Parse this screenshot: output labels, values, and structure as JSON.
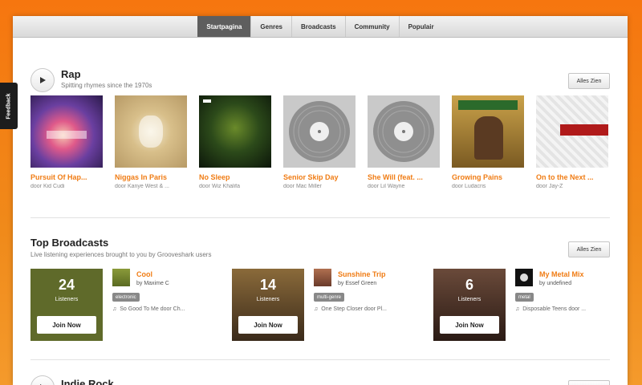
{
  "nav": {
    "tabs": [
      "Startpagina",
      "Genres",
      "Broadcasts",
      "Community",
      "Populair"
    ],
    "active": 0
  },
  "feedback": "Feedback",
  "rap": {
    "title": "Rap",
    "subtitle": "Spitting rhymes since the 1970s",
    "see_all": "Alles Zien",
    "albums": [
      {
        "title": "Pursuit Of Hap...",
        "artist": "door Kid Cudi"
      },
      {
        "title": "Niggas In Paris",
        "artist": "door Kanye West & ..."
      },
      {
        "title": "No Sleep",
        "artist": "door Wiz Khalifa"
      },
      {
        "title": "Senior Skip Day",
        "artist": "door Mac Miller"
      },
      {
        "title": "She Will (feat. ...",
        "artist": "door Lil Wayne"
      },
      {
        "title": "Growing Pains",
        "artist": "door Ludacris"
      },
      {
        "title": "On to the Next ...",
        "artist": "door Jay-Z"
      }
    ]
  },
  "broadcasts": {
    "title": "Top Broadcasts",
    "subtitle": "Live listening experiences brought to you by Grooveshark users",
    "see_all": "Alles Zien",
    "items": [
      {
        "count": "24",
        "listeners": "Listeners",
        "join": "Join Now",
        "name": "Cool",
        "by": "by Maxime C",
        "tag": "electronic",
        "song": "So Good To Me door Ch..."
      },
      {
        "count": "14",
        "listeners": "Listeners",
        "join": "Join Now",
        "name": "Sunshine Trip",
        "by": "by Essef Green",
        "tag": "multi-genre",
        "song": "One Step Closer door Pl..."
      },
      {
        "count": "6",
        "listeners": "Listeners",
        "join": "Join Now",
        "name": "My Metal Mix",
        "by": "by undefined",
        "tag": "metal",
        "song": "Disposable Teens door ..."
      }
    ]
  },
  "indie": {
    "title": "Indie Rock"
  }
}
